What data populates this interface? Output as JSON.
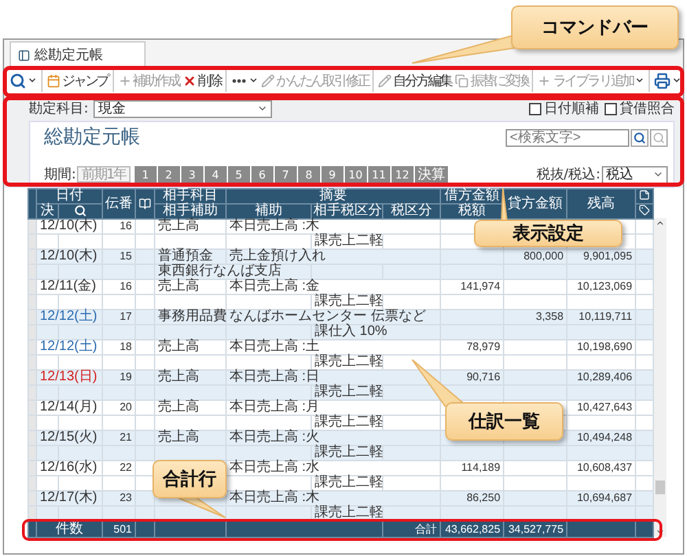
{
  "window": {
    "tab": "総勘定元帳"
  },
  "toolbar": {
    "left": [
      {
        "kind": "search",
        "dropdown": true,
        "disabled": false
      },
      {
        "kind": "separator"
      },
      {
        "kind": "jump",
        "label": "ジャンプ",
        "disabled": false
      },
      {
        "kind": "separator"
      },
      {
        "kind": "add",
        "label": "補助作成",
        "disabled": true
      },
      {
        "kind": "delete",
        "label": "削除",
        "disabled": false
      },
      {
        "kind": "separator"
      },
      {
        "kind": "more",
        "dropdown": true,
        "disabled": false
      }
    ],
    "right": [
      {
        "kind": "edit",
        "label": "かんたん取引修正",
        "disabled": true
      },
      {
        "kind": "separator"
      },
      {
        "kind": "edit",
        "label": "自分方編集",
        "disabled": false
      },
      {
        "kind": "copy",
        "label": "振替に変換",
        "disabled": true
      },
      {
        "kind": "separator"
      },
      {
        "kind": "add",
        "label": "ライブラリ追加",
        "dropdown": true,
        "disabled": true
      },
      {
        "kind": "separator"
      },
      {
        "kind": "print",
        "dropdown": true,
        "disabled": false
      }
    ]
  },
  "settings": {
    "account_label": "勘定科目:",
    "account": "現金",
    "options": [
      {
        "label": "日付順補",
        "checked": false
      },
      {
        "label": "貸借照合",
        "checked": false
      }
    ],
    "title": "総勘定元帳",
    "search_placeholder": "<検索文字>",
    "period_label": "期間:",
    "period_button": "前期1年",
    "months": [
      "1",
      "2",
      "3",
      "4",
      "5",
      "6",
      "7",
      "8",
      "9",
      "10",
      "11",
      "12",
      "決算"
    ],
    "tax_label": "税抜/税込:",
    "tax": "税込"
  },
  "table": {
    "header": {
      "date": "日付",
      "settle": "決",
      "number": "伝番",
      "account": "相手科目",
      "sub_account": "相手補助",
      "summary": "摘要",
      "sub": "補助",
      "partner_tax": "相手税区分",
      "tax": "税区分",
      "debit": "借方金額",
      "tax_amount": "税額",
      "credit": "貸方金額",
      "balance": "残高"
    },
    "rows": [
      {
        "date": "12/10(木)",
        "kind": "weekday",
        "number": "16",
        "account": "売上高",
        "summary": "本日売上高 :木",
        "partner_tax": "課売上二軽"
      },
      {
        "date": "12/10(木)",
        "kind": "weekday",
        "number": "15",
        "account": "普通預金",
        "summary": "売上金預け入れ",
        "credit": "800,000",
        "balance": "9,901,095",
        "sub_account": "東西銀行なんば支店"
      },
      {
        "date": "12/11(金)",
        "kind": "weekday",
        "number": "16",
        "account": "売上高",
        "summary": "本日売上高 :金",
        "debit": "141,974",
        "balance": "10,123,069",
        "partner_tax": "課売上二軽"
      },
      {
        "date": "12/12(土)",
        "kind": "saturday",
        "number": "17",
        "account": "事務用品費",
        "summary": "なんばホームセンター 伝票など",
        "credit": "3,358",
        "balance": "10,119,711",
        "partner_tax": "課仕入 10%"
      },
      {
        "date": "12/12(土)",
        "kind": "saturday",
        "number": "18",
        "account": "売上高",
        "summary": "本日売上高 :土",
        "debit": "78,979",
        "balance": "10,198,690",
        "partner_tax": "課売上二軽"
      },
      {
        "date": "12/13(日)",
        "kind": "sunday",
        "number": "19",
        "account": "売上高",
        "summary": "本日売上高 :日",
        "debit": "90,716",
        "balance": "10,289,406",
        "partner_tax": "課売上二軽"
      },
      {
        "date": "12/14(月)",
        "kind": "weekday",
        "number": "20",
        "account": "売上高",
        "summary": "本日売上高 :月",
        "balance": "10,427,643",
        "partner_tax": "課売上二軽"
      },
      {
        "date": "12/15(火)",
        "kind": "weekday",
        "number": "21",
        "account": "売上高",
        "summary": "本日売上高 :火",
        "balance": "10,494,248",
        "partner_tax": "課売上二軽"
      },
      {
        "date": "12/16(水)",
        "kind": "weekday",
        "number": "22",
        "summary": "本日売上高 :水",
        "debit": "114,189",
        "balance": "10,608,437",
        "partner_tax": "課売上二軽"
      },
      {
        "date": "12/17(木)",
        "kind": "weekday",
        "number": "23",
        "summary": "本日売上高 :木",
        "debit": "86,250",
        "balance": "10,694,687",
        "partner_tax": "課売上二軽"
      }
    ],
    "total": {
      "label": "件数",
      "count": "501",
      "sum_label": "合計",
      "debit": "43,662,825",
      "credit": "34,527,775"
    }
  },
  "callouts": [
    "コマンドバー",
    "表示設定",
    "仕訳一覧",
    "合計行"
  ]
}
